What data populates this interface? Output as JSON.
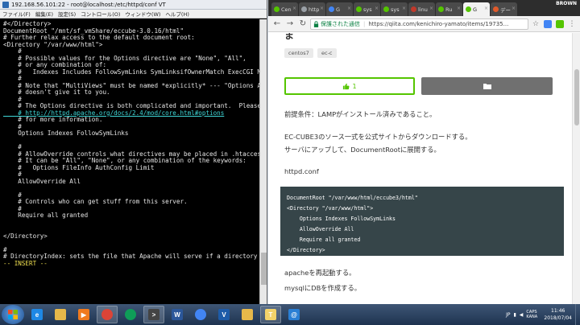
{
  "terminal": {
    "title": "192.168.56.101:22 - root@localhost:/etc/httpd/conf VT",
    "menu": [
      "ファイル(F)",
      "編集(E)",
      "設定(S)",
      "コントロール(O)",
      "ウィンドウ(W)",
      "ヘルプ(H)"
    ],
    "lines": [
      {
        "text": "#</Directory>",
        "style": "normal"
      },
      {
        "text": "DocumentRoot \"/mnt/sf_vmShare/eccube-3.0.16/html\"",
        "style": "normal"
      },
      {
        "text": "# Further relax access to the default document root:",
        "style": "normal"
      },
      {
        "text": "<Directory \"/var/www/html\">",
        "style": "normal"
      },
      {
        "text": "    #",
        "style": "normal"
      },
      {
        "text": "    # Possible values for the Options directive are \"None\", \"All\",",
        "style": "normal"
      },
      {
        "text": "    # or any combination of:",
        "style": "normal"
      },
      {
        "text": "    #   Indexes Includes FollowSymLinks SymLinksifOwnerMatch ExecCGI MultiVie",
        "style": "normal"
      },
      {
        "text": "    #",
        "style": "normal"
      },
      {
        "text": "    # Note that \"MultiViews\" must be named *explicitly* --- \"Options All\"",
        "style": "normal"
      },
      {
        "text": "    # doesn't give it to you.",
        "style": "normal"
      },
      {
        "text": "    #",
        "style": "normal"
      },
      {
        "text": "    # The Options directive is both complicated and important.  Please see",
        "style": "normal"
      },
      {
        "text": "    # http://httpd.apache.org/docs/2.4/mod/core.html#options",
        "style": "link"
      },
      {
        "text": "    # for more information.",
        "style": "normal"
      },
      {
        "text": "    #",
        "style": "normal"
      },
      {
        "text": "    Options Indexes FollowSymLinks",
        "style": "normal"
      },
      {
        "text": "",
        "style": "normal"
      },
      {
        "text": "    #",
        "style": "normal"
      },
      {
        "text": "    # AllowOverride controls what directives may be placed in .htaccess files.",
        "style": "normal"
      },
      {
        "text": "    # It can be \"All\", \"None\", or any combination of the keywords:",
        "style": "normal"
      },
      {
        "text": "    #   Options FileInfo AuthConfig Limit",
        "style": "normal"
      },
      {
        "text": "    #",
        "style": "normal"
      },
      {
        "text": "    AllowOverride All",
        "style": "normal"
      },
      {
        "text": "",
        "style": "normal"
      },
      {
        "text": "    #",
        "style": "normal"
      },
      {
        "text": "    # Controls who can get stuff from this server.",
        "style": "normal"
      },
      {
        "text": "    #",
        "style": "normal"
      },
      {
        "text": "    Require all granted",
        "style": "normal"
      },
      {
        "text": "",
        "style": "normal"
      },
      {
        "text": "",
        "style": "normal"
      },
      {
        "text": "</Directory>",
        "style": "normal"
      },
      {
        "text": "",
        "style": "normal"
      },
      {
        "text": "#",
        "style": "normal"
      },
      {
        "text": "# DirectoryIndex: sets the file that Apache will serve if a directory",
        "style": "normal"
      },
      {
        "text": "-- INSERT --",
        "style": "insert"
      }
    ]
  },
  "browser": {
    "profile": "BROWN",
    "tabs": [
      {
        "label": "Cen",
        "favicon_color": "#55c500",
        "active": false
      },
      {
        "label": "http",
        "favicon_color": "#9aa0a6",
        "active": false
      },
      {
        "label": "G",
        "favicon_color": "#4285f4",
        "active": false
      },
      {
        "label": "sys",
        "favicon_color": "#55c500",
        "active": false
      },
      {
        "label": "sys",
        "favicon_color": "#55c500",
        "active": false
      },
      {
        "label": "linu",
        "favicon_color": "#c0392b",
        "active": false
      },
      {
        "label": "Ru",
        "favicon_color": "#55c500",
        "active": false
      },
      {
        "label": "G",
        "favicon_color": "#55c500",
        "active": true
      },
      {
        "label": "デー",
        "favicon_color": "#e05a2b",
        "active": false
      }
    ],
    "secure_label": "保護された通信",
    "url": "https://qiita.com/kenichiro-yamato/items/19735..."
  },
  "article": {
    "title": "ま",
    "tags": [
      "centos7",
      "ec-c"
    ],
    "like_count": "1",
    "paragraphs": [
      "前提条件：LAMPがインストール済みであること。",
      "EC-CUBE3のソース一式を公式サイトからダウンロードする。",
      "サーバにアップして、DocumentRootに展開する。",
      "httpd.conf"
    ],
    "code_lines": [
      "DocumentRoot \"/var/www/html/eccube3/html\"",
      "<Directory \"/var/www/html\">",
      "    Options Indexes FollowSymLinks",
      "    AllowOverride All",
      "    Require all granted",
      "</Directory>"
    ],
    "after_code": [
      "apacheを再起動する。",
      "mysqlにDBを作成する。"
    ]
  },
  "taskbar": {
    "apps": [
      {
        "name": "ie-icon",
        "color": "#1e88e5",
        "label": "e"
      },
      {
        "name": "explorer-icon",
        "color": "#e6b84a",
        "label": ""
      },
      {
        "name": "media-player-icon",
        "color": "#f07a1e",
        "label": "▶"
      },
      {
        "name": "chrome-icon",
        "color": "#db4437",
        "label": "",
        "active": true
      },
      {
        "name": "chrome-icon",
        "color": "#0f9d58",
        "label": ""
      },
      {
        "name": "terminal-icon",
        "color": "#444444",
        "label": ">",
        "active": true
      },
      {
        "name": "word-icon",
        "color": "#2b579a",
        "label": "W"
      },
      {
        "name": "chrome-icon",
        "color": "#4285f4",
        "label": ""
      },
      {
        "name": "virtualbox-icon",
        "color": "#1d5ba8",
        "label": "V"
      },
      {
        "name": "explorer-icon",
        "color": "#e6b84a",
        "label": ""
      },
      {
        "name": "notepad-icon",
        "color": "#f3d36a",
        "label": "T",
        "active": true
      },
      {
        "name": "mail-icon",
        "color": "#2a7fd4",
        "label": "@"
      }
    ],
    "tray_lang": "JP",
    "tray_caps": "CAPS KANA",
    "time": "11:46",
    "date": "2018/07/04"
  }
}
